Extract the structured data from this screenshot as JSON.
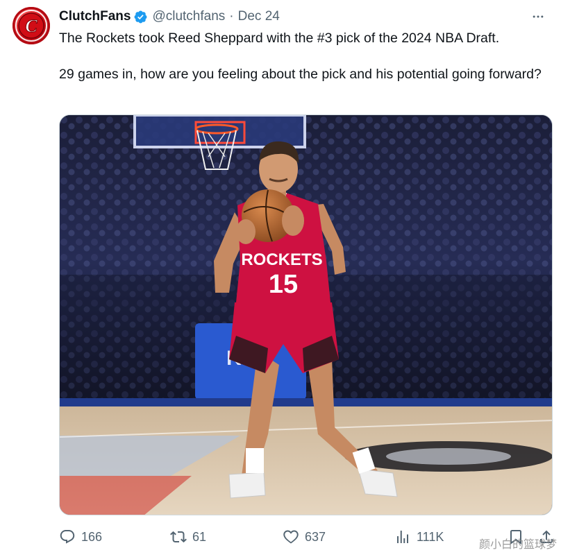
{
  "tweet": {
    "author": {
      "display_name": "ClutchFans",
      "handle": "@clutchfans",
      "avatar_letter": "C"
    },
    "separator": "·",
    "date": "Dec 24",
    "text_line1": "The Rockets took Reed Sheppard with the #3 pick of the 2024 NBA Draft.",
    "text_line2": "29 games in, how are you feeling about the pick and his potential going forward?",
    "media": {
      "jersey_team": "ROCKETS",
      "jersey_number": "15",
      "court_logo": "K"
    },
    "actions": {
      "replies": "166",
      "reposts": "61",
      "likes": "637",
      "views": "111K"
    }
  },
  "watermark": "颜小白的篮球梦",
  "colors": {
    "verified": "#1d9bf0",
    "muted": "#536471",
    "rockets_red": "#ce1141"
  }
}
